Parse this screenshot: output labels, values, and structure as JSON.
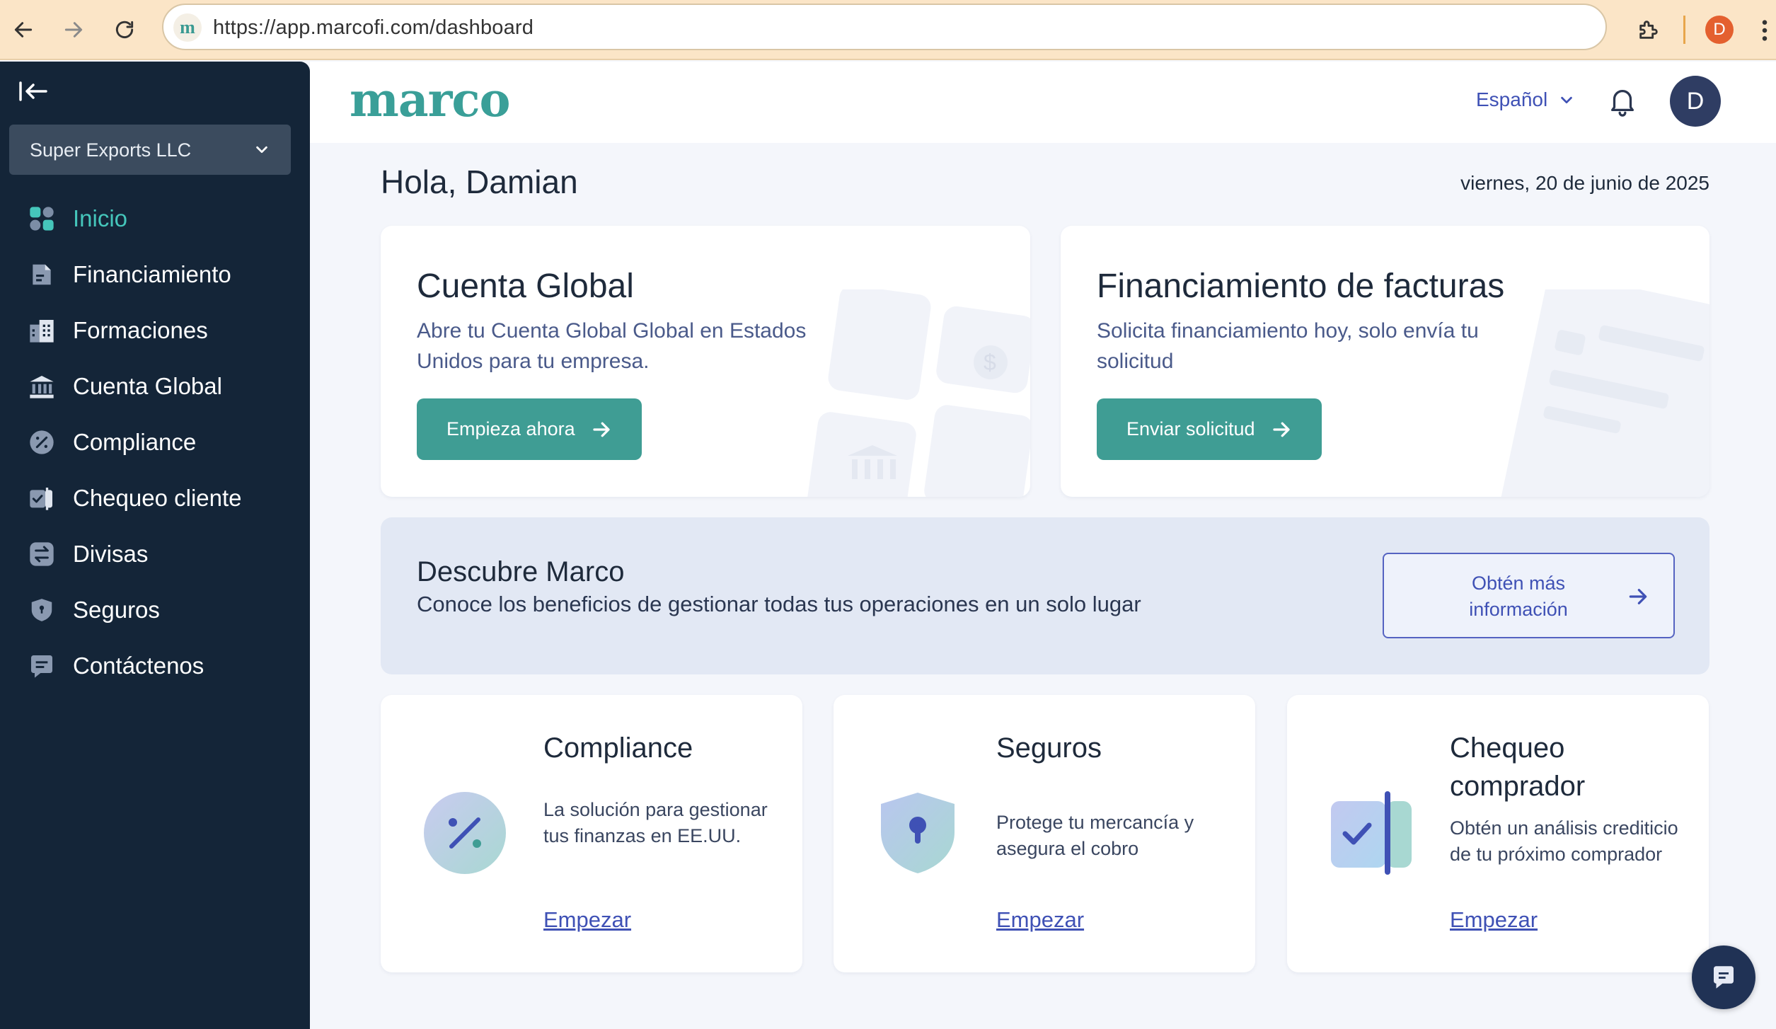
{
  "browser": {
    "url": "https://app.marcofi.com/dashboard",
    "profile_initial": "D",
    "favicon_letter": "m"
  },
  "sidebar": {
    "company": "Super Exports LLC",
    "items": [
      {
        "label": "Inicio",
        "icon": "grid-icon",
        "active": true
      },
      {
        "label": "Financiamiento",
        "icon": "document-icon"
      },
      {
        "label": "Formaciones",
        "icon": "building-icon"
      },
      {
        "label": "Cuenta Global",
        "icon": "bank-icon"
      },
      {
        "label": "Compliance",
        "icon": "percent-icon"
      },
      {
        "label": "Chequeo cliente",
        "icon": "check-icon"
      },
      {
        "label": "Divisas",
        "icon": "exchange-icon"
      },
      {
        "label": "Seguros",
        "icon": "shield-icon"
      },
      {
        "label": "Contáctenos",
        "icon": "chat-icon"
      }
    ]
  },
  "header": {
    "logo": "marco",
    "language": "Español",
    "user_initial": "D"
  },
  "main": {
    "greeting": "Hola, Damian",
    "date": "viernes, 20 de junio de 2025",
    "cards": [
      {
        "title": "Cuenta Global",
        "description": "Abre tu Cuenta Global Global en Estados Unidos para tu empresa.",
        "button": "Empieza ahora"
      },
      {
        "title": "Financiamiento de facturas",
        "description": "Solicita financiamiento hoy, solo envía tu solicitud",
        "button": "Enviar solicitud"
      }
    ],
    "banner": {
      "title": "Descubre Marco",
      "description": "Conoce los beneficios de gestionar todas tus operaciones en un solo lugar",
      "button": "Obtén más información"
    },
    "features": [
      {
        "title": "Compliance",
        "description": "La solución para gestionar tus finanzas en EE.UU.",
        "link": "Empezar"
      },
      {
        "title": "Seguros",
        "description": "Protege tu mercancía y asegura el cobro",
        "link": "Empezar"
      },
      {
        "title": "Chequeo comprador",
        "description": "Obtén un análisis crediticio de tu próximo comprador",
        "link": "Empezar"
      }
    ]
  },
  "colors": {
    "accent": "#3f9d94",
    "sidebar_bg": "#142538",
    "link": "#3f51b5",
    "active_nav": "#45c6bb"
  }
}
